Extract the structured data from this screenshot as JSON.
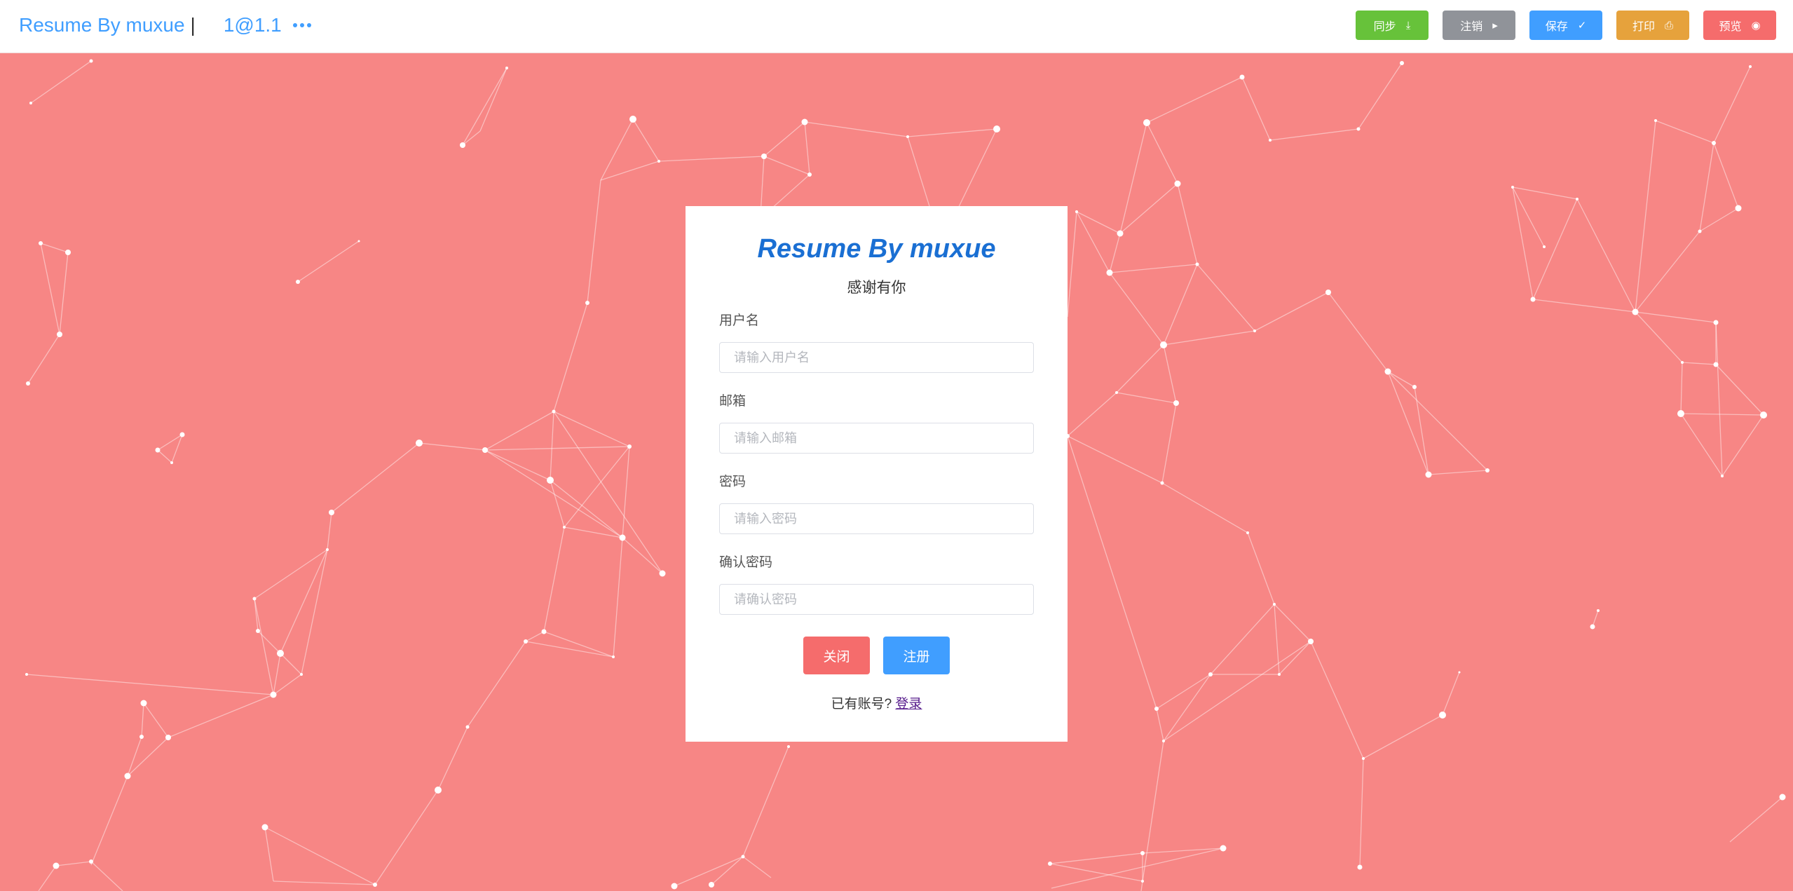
{
  "header": {
    "brand": "Resume By muxue",
    "separator": "|",
    "version": "1@1.1",
    "more_icon": "ellipsis-icon"
  },
  "toolbar": {
    "sync": {
      "label": "同步",
      "icon": "download-icon",
      "color": "#67c23a"
    },
    "logout": {
      "label": "注销",
      "icon": "caret-right-icon",
      "color": "#909399"
    },
    "save": {
      "label": "保存",
      "icon": "check-icon",
      "color": "#409eff"
    },
    "print": {
      "label": "打印",
      "icon": "printer-icon",
      "color": "#e6a23c"
    },
    "preview": {
      "label": "预览",
      "icon": "eye-icon",
      "color": "#f56c6c"
    }
  },
  "background": {
    "color": "#f78685",
    "pattern": "particle-network"
  },
  "register_form": {
    "title": "Resume By muxue",
    "subtitle": "感谢有你",
    "username": {
      "label": "用户名",
      "placeholder": "请输入用户名",
      "value": ""
    },
    "email": {
      "label": "邮箱",
      "placeholder": "请输入邮箱",
      "value": ""
    },
    "password": {
      "label": "密码",
      "placeholder": "请输入密码",
      "value": ""
    },
    "confirm_password": {
      "label": "确认密码",
      "placeholder": "请确认密码",
      "value": ""
    },
    "close_label": "关闭",
    "register_label": "注册",
    "footer_text": "已有账号?",
    "login_link": "登录"
  }
}
